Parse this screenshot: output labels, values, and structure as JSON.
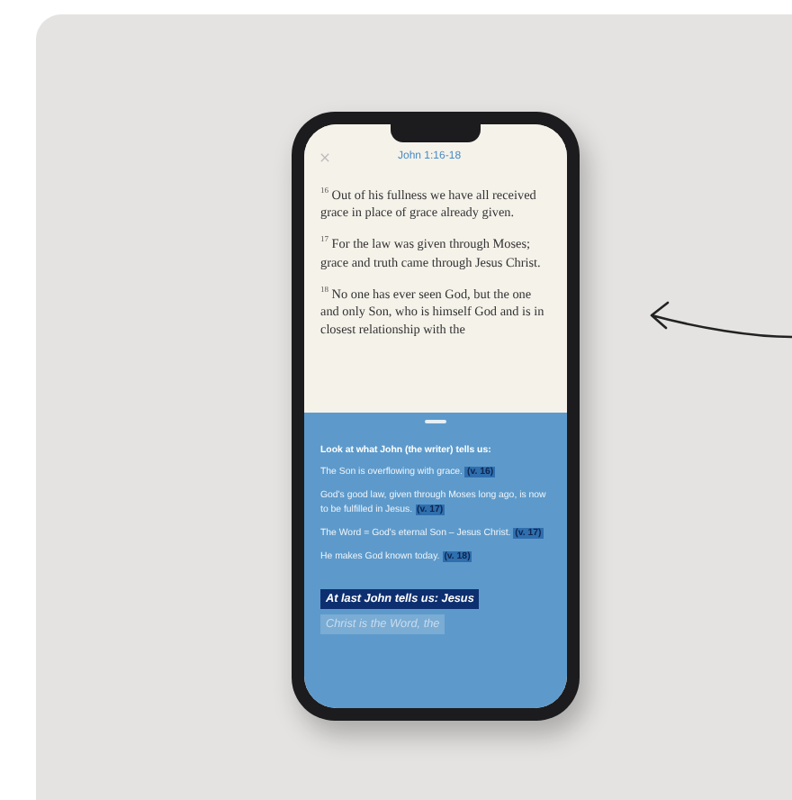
{
  "screen": {
    "title": "John 1:16-18",
    "verses": [
      {
        "number": "16",
        "text": "Out of his fullness we have all received grace in place of grace already given."
      },
      {
        "number": "17",
        "text": "For the law was given through Moses; grace and truth came through Jesus Christ."
      },
      {
        "number": "18",
        "text": "No one has ever seen God, but the one and only Son, who is himself God and is in closest relationship with the"
      }
    ],
    "panel": {
      "heading": "Look at what John (the writer) tells us:",
      "points": [
        {
          "text": "The Son is overflowing with grace.",
          "ref": "(v. 16)"
        },
        {
          "text": "God's good law, given through Moses long ago, is now to be fulfilled in Jesus.",
          "ref": "(v. 17)"
        },
        {
          "text": "The Word = God's eternal Son – Jesus Christ.",
          "ref": "(v. 17)"
        },
        {
          "text": "He makes God known today.",
          "ref": "(v. 18)"
        }
      ],
      "notes": [
        {
          "kind": "highlight",
          "text": "At last John tells us: Jesus"
        },
        {
          "kind": "faded",
          "text": "Christ is the Word, the"
        }
      ]
    }
  }
}
